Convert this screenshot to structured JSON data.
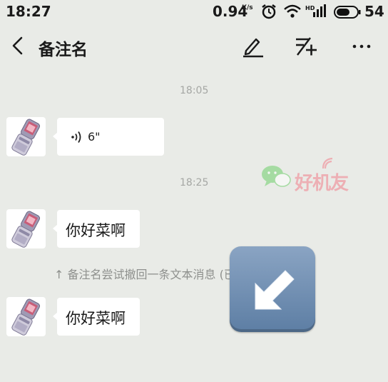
{
  "status_bar": {
    "time": "18:27",
    "network_speed": "0.94",
    "network_unit": "K/s",
    "battery": "54"
  },
  "header": {
    "title": "备注名"
  },
  "messages": [
    {
      "timestamp": "18:05"
    },
    {
      "type": "voice",
      "duration": "6\""
    },
    {
      "timestamp": "18:25"
    },
    {
      "type": "text",
      "text": "你好菜啊"
    },
    {
      "type": "system",
      "text": "↑ 备注名尝试撤回一条文本消息 (已阻止)"
    },
    {
      "type": "text",
      "text": "你好菜啊"
    }
  ],
  "watermark": {
    "text": "好机友"
  },
  "overlay_icon": "down-left-arrow-emoji",
  "colors": {
    "background": "#e9ebe7",
    "bubble": "#ffffff",
    "watermark": "#f27f8b",
    "emoji_blue": "#6b88ad"
  }
}
